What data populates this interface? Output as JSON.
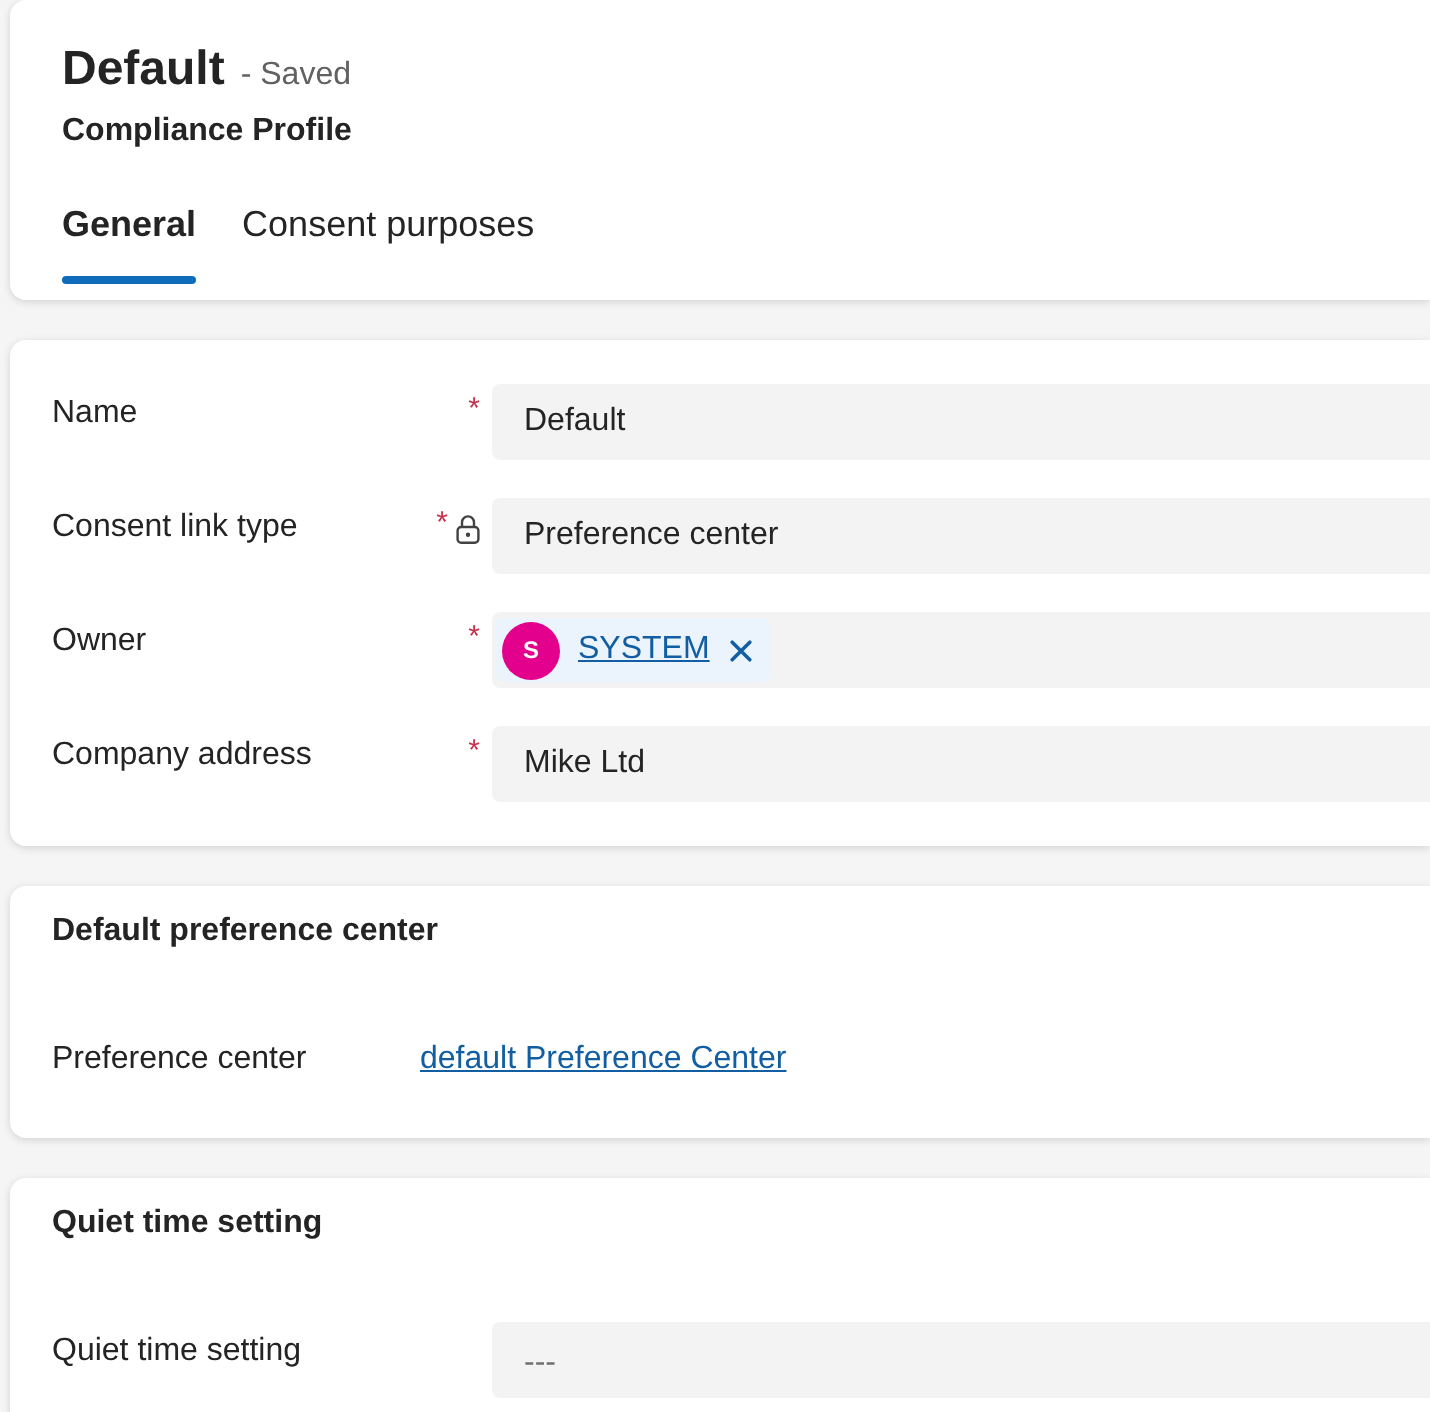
{
  "header": {
    "title": "Default",
    "save_status": "- Saved",
    "entity": "Compliance Profile"
  },
  "tabs": [
    {
      "label": "General",
      "selected": true
    },
    {
      "label": "Consent purposes",
      "selected": false
    }
  ],
  "sections": [
    {
      "fields": [
        {
          "label": "Name",
          "required_mark": "*",
          "locked": false,
          "kind": "text",
          "value": "Default"
        },
        {
          "label": "Consent link type",
          "required_mark": "*",
          "locked": true,
          "kind": "text",
          "value": "Preference center"
        },
        {
          "label": "Owner",
          "required_mark": "*",
          "locked": false,
          "kind": "lookup",
          "avatar_initial": "S",
          "value": "SYSTEM"
        },
        {
          "label": "Company address",
          "required_mark": "*",
          "locked": false,
          "kind": "text",
          "value": "Mike Ltd"
        }
      ]
    },
    {
      "title": "Default preference center",
      "fields": [
        {
          "label": "Preference center",
          "kind": "link",
          "value": "default Preference Center"
        }
      ]
    },
    {
      "title": "Quiet time setting",
      "fields": [
        {
          "label": "Quiet time setting",
          "kind": "text",
          "placeholder": "---"
        }
      ]
    }
  ]
}
